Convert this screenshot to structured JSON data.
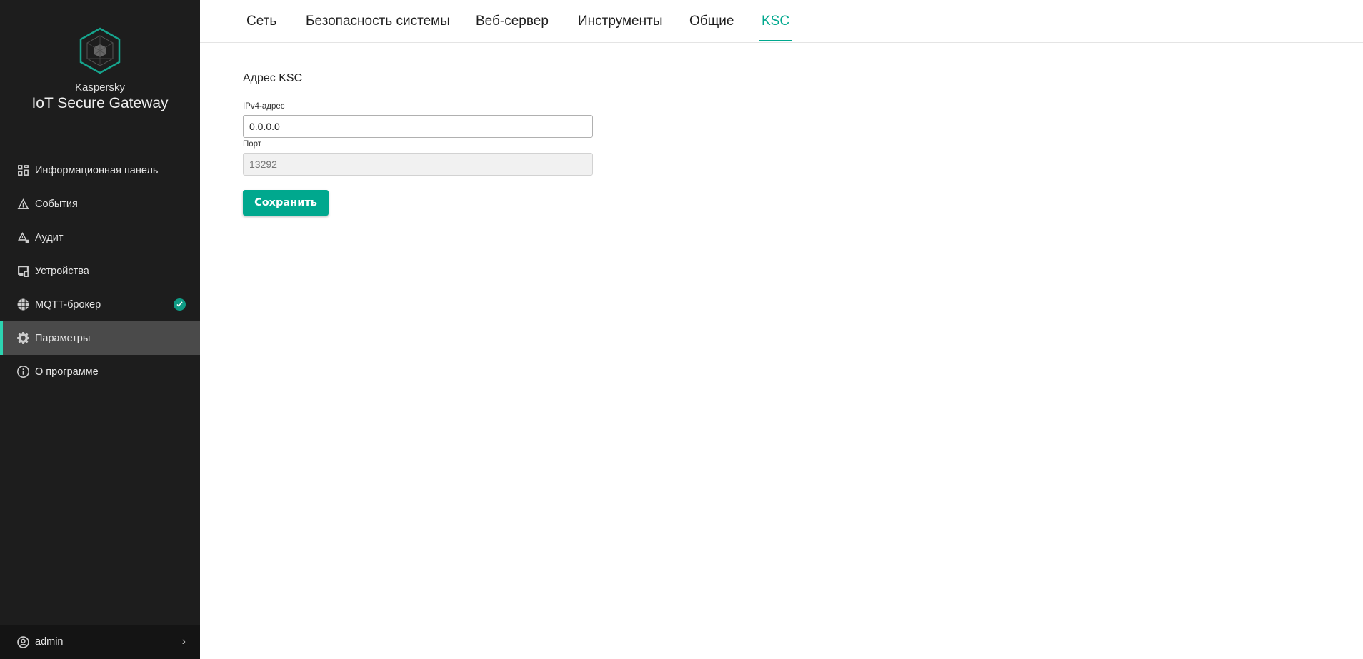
{
  "brand": {
    "vendor": "Kaspersky",
    "product": "IoT Secure Gateway"
  },
  "sidebar": {
    "items": [
      {
        "label": "Информационная панель",
        "icon": "dashboard-icon"
      },
      {
        "label": "События",
        "icon": "warning-icon"
      },
      {
        "label": "Аудит",
        "icon": "audit-icon"
      },
      {
        "label": "Устройства",
        "icon": "devices-icon"
      },
      {
        "label": "MQTT-брокер",
        "icon": "globe-icon",
        "status": "ok"
      },
      {
        "label": "Параметры",
        "icon": "gear-icon",
        "active": true
      },
      {
        "label": "О программе",
        "icon": "info-icon"
      }
    ],
    "user": "admin"
  },
  "tabs": [
    "Сеть",
    "Безопасность системы",
    "Веб-сервер",
    "Инструменты",
    "Общие",
    "KSC"
  ],
  "active_tab": "KSC",
  "form": {
    "title": "Адрес KSC",
    "ipv4_label": "IPv4-адрес",
    "ipv4_value": "0.0.0.0",
    "port_label": "Порт",
    "port_placeholder": "13292",
    "save_label": "Сохранить"
  },
  "colors": {
    "accent": "#00a88e",
    "sidebar": "#1d1d1d"
  }
}
